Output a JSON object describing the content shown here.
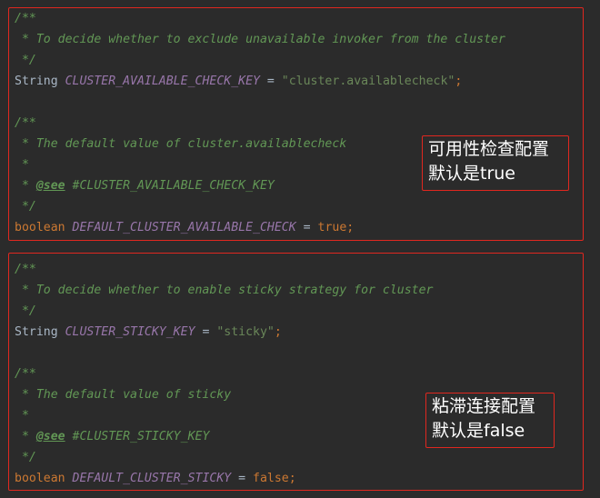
{
  "blocks": [
    {
      "doc1": {
        "open": "/**",
        "text": " * To decide whether to exclude unavailable invoker from the cluster",
        "close": " */"
      },
      "decl1": {
        "type": "String",
        "name": "CLUSTER_AVAILABLE_CHECK_KEY",
        "eq": " = ",
        "value": "\"cluster.availablecheck\"",
        "semi": ";"
      },
      "doc2": {
        "open": "/**",
        "text": " * The default value of cluster.availablecheck",
        "blank": " *",
        "see_prefix": " * ",
        "see_tag": "@see",
        "see_ref": " #CLUSTER_AVAILABLE_CHECK_KEY",
        "close": " */"
      },
      "decl2": {
        "type": "boolean",
        "name": "DEFAULT_CLUSTER_AVAILABLE_CHECK",
        "eq": " = ",
        "value": "true",
        "semi": ";"
      },
      "note": {
        "line1": "可用性检查配置",
        "line2": "默认是true"
      }
    },
    {
      "doc1": {
        "open": "/**",
        "text": " * To decide whether to enable sticky strategy for cluster",
        "close": " */"
      },
      "decl1": {
        "type": "String",
        "name": "CLUSTER_STICKY_KEY",
        "eq": " = ",
        "value": "\"sticky\"",
        "semi": ";"
      },
      "doc2": {
        "open": "/**",
        "text": " * The default value of sticky",
        "blank": " *",
        "see_prefix": " * ",
        "see_tag": "@see",
        "see_ref": " #CLUSTER_STICKY_KEY",
        "close": " */"
      },
      "decl2": {
        "type": "boolean",
        "name": "DEFAULT_CLUSTER_STICKY",
        "eq": " = ",
        "value": "false",
        "semi": ";"
      },
      "note": {
        "line1": "粘滞连接配置",
        "line2": "默认是false"
      }
    }
  ],
  "colors": {
    "background": "#2b2b2b",
    "highlight_border": "#e0271f",
    "comment": "#629755",
    "keyword": "#cc7832",
    "constant": "#9876aa",
    "string": "#6a8759",
    "plain": "#a9b7c6"
  }
}
